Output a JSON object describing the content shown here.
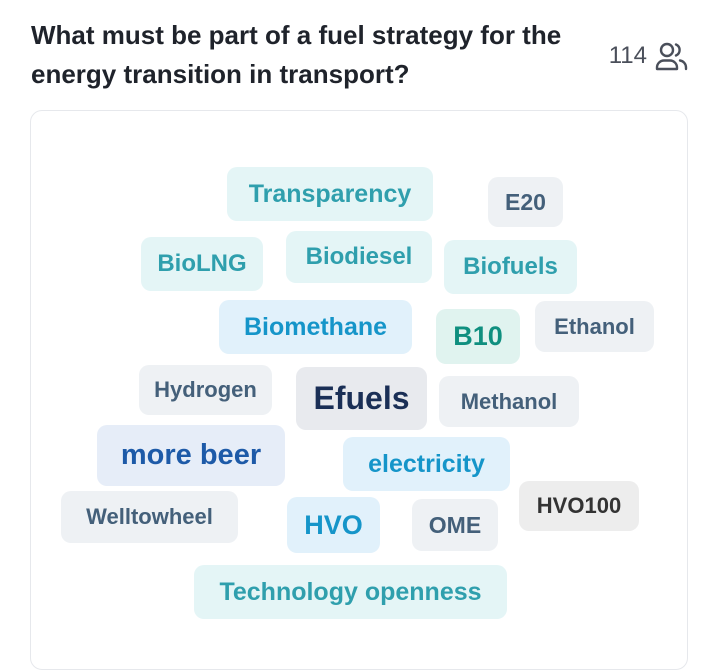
{
  "question": {
    "text": "What must be part of a fuel strategy for the energy transition in transport?"
  },
  "respondents": {
    "count": "114",
    "icon": "users-icon"
  },
  "word_cloud": {
    "words": [
      {
        "text": "Transparency",
        "color": "#2f9fad"
      },
      {
        "text": "E20",
        "color": "#44607a"
      },
      {
        "text": "BioLNG",
        "color": "#2f9fad"
      },
      {
        "text": "Biodiesel",
        "color": "#2f9fad"
      },
      {
        "text": "Biofuels",
        "color": "#2f9fad"
      },
      {
        "text": "Biomethane",
        "color": "#1595c9"
      },
      {
        "text": "B10",
        "color": "#0f8f7f"
      },
      {
        "text": "Ethanol",
        "color": "#44607a"
      },
      {
        "text": "Hydrogen",
        "color": "#44607a"
      },
      {
        "text": "Efuels",
        "color": "#1a2f56"
      },
      {
        "text": "Methanol",
        "color": "#44607a"
      },
      {
        "text": "more beer",
        "color": "#1d5aa8"
      },
      {
        "text": "electricity",
        "color": "#1595c9"
      },
      {
        "text": "HVO100",
        "color": "#333333"
      },
      {
        "text": "Welltowheel",
        "color": "#44607a"
      },
      {
        "text": "HVO",
        "color": "#1595c9"
      },
      {
        "text": "OME",
        "color": "#44607a"
      },
      {
        "text": "Technology openness",
        "color": "#2f9fad"
      }
    ]
  }
}
